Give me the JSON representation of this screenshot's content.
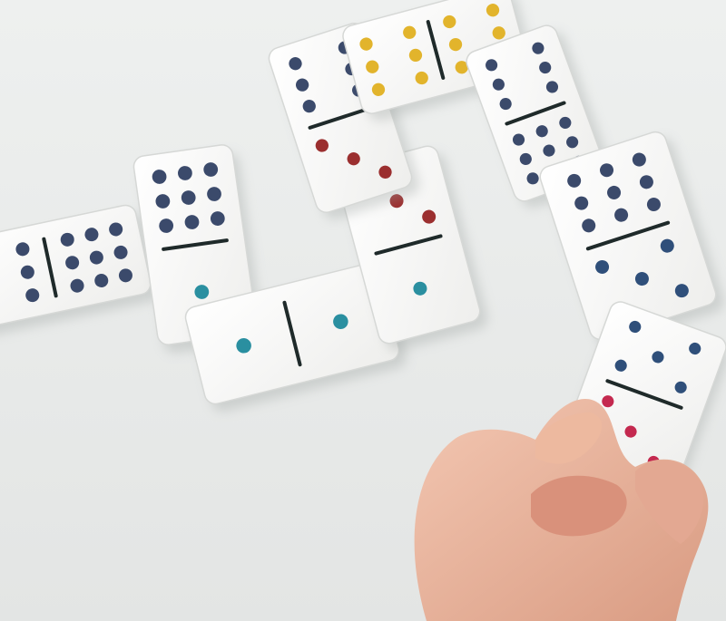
{
  "scene": {
    "subject": "dominoes",
    "background_color": "#e9ebea",
    "tile_color": "#f7f7f5",
    "divider_color": "#1f2a2a",
    "skin_color": "#e9b29a"
  },
  "pip_colors": {
    "6": "#3b4a6b",
    "9": "#3b4a6b",
    "5": "#2f4f7a",
    "1": "#2a8fa0",
    "3": "#9b2f2f",
    "12": "#e2b42c",
    "red": "#c4294f",
    "yellow": "#e2b42c"
  },
  "dominoes": [
    {
      "ends": [
        6,
        9
      ]
    },
    {
      "ends": [
        9,
        1
      ]
    },
    {
      "ends": [
        1,
        1
      ]
    },
    {
      "ends": [
        3,
        1
      ]
    },
    {
      "ends": [
        6,
        3
      ]
    },
    {
      "ends": [
        6,
        6
      ]
    },
    {
      "ends": [
        6,
        9
      ]
    },
    {
      "ends": [
        9,
        5
      ]
    },
    {
      "ends": [
        5,
        3
      ]
    }
  ]
}
